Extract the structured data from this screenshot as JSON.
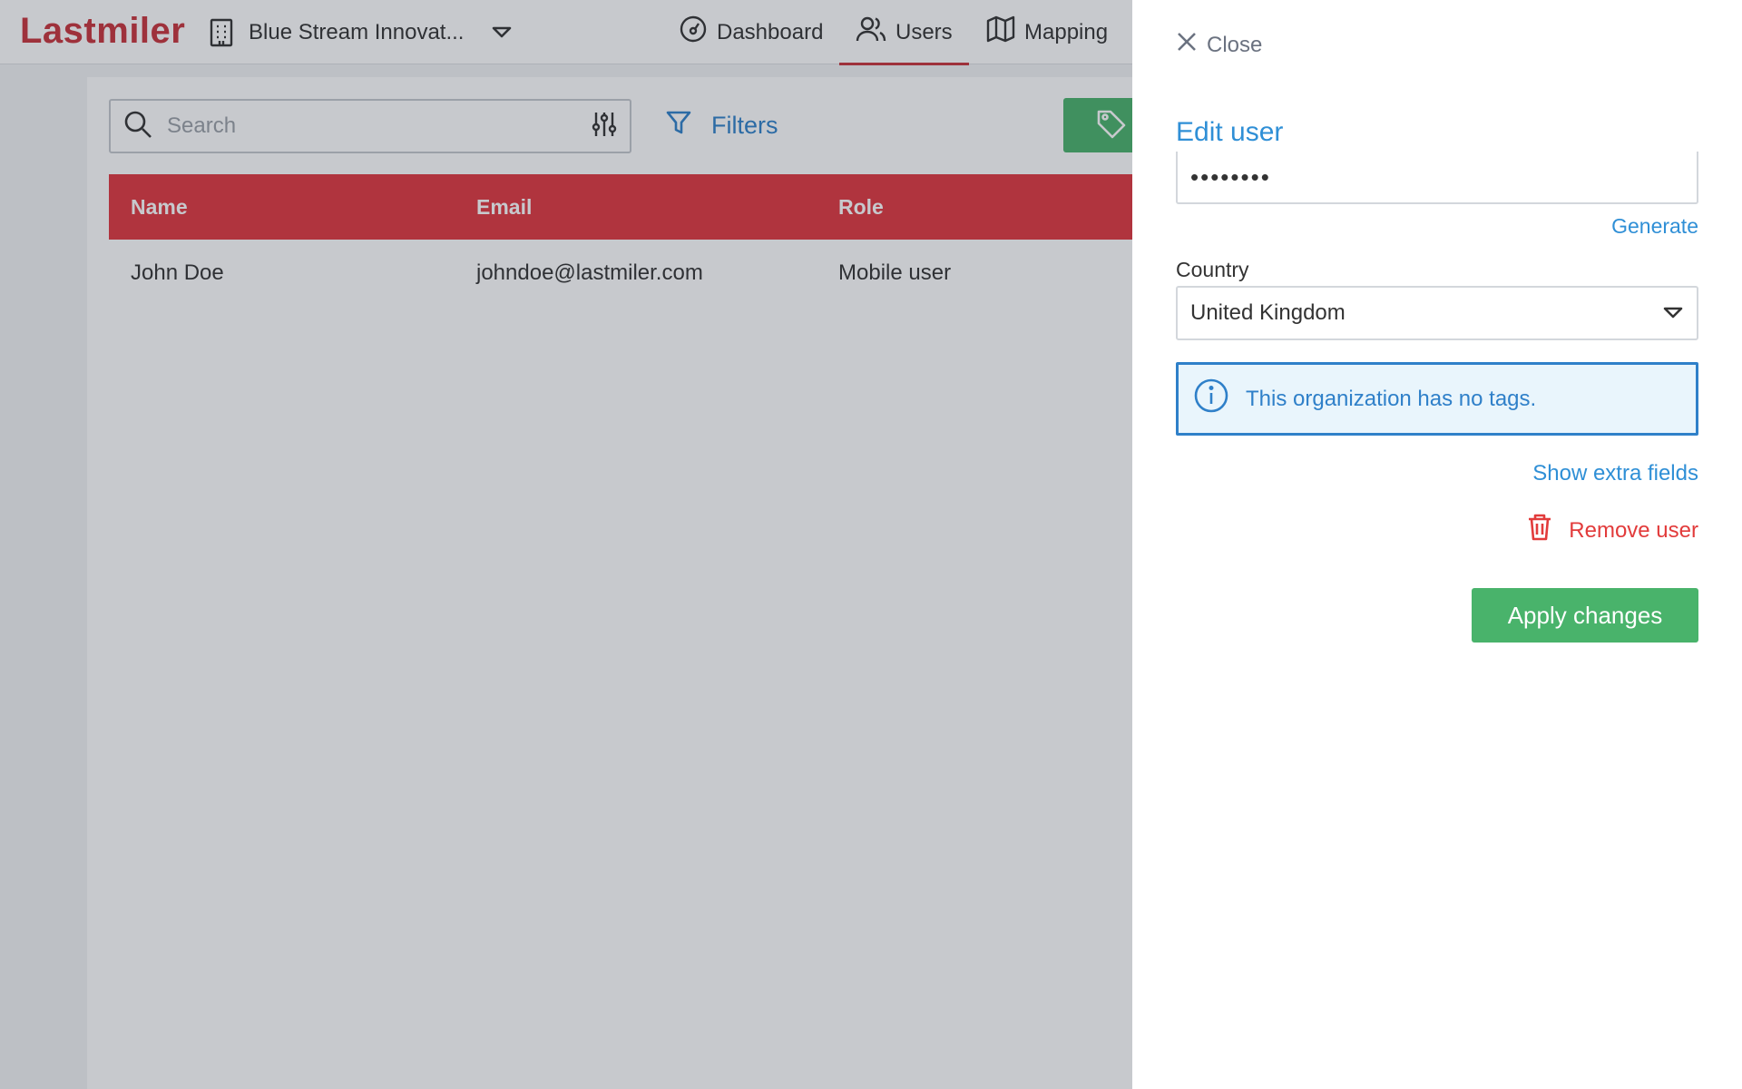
{
  "app": {
    "logo_text": "Lastmiler",
    "brand_color": "#c8323a"
  },
  "header": {
    "organization": "Blue Stream Innovat...",
    "nav": [
      {
        "label": "Dashboard",
        "icon": "dashboard-gauge-icon"
      },
      {
        "label": "Users",
        "icon": "users-icon",
        "active": true
      },
      {
        "label": "Mapping",
        "icon": "map-icon"
      }
    ]
  },
  "toolbar": {
    "search_placeholder": "Search",
    "filters_label": "Filters"
  },
  "table": {
    "columns": [
      "Name",
      "Email",
      "Role"
    ],
    "rows": [
      {
        "name": "John Doe",
        "email": "johndoe@lastmiler.com",
        "role": "Mobile user"
      }
    ]
  },
  "panel": {
    "close_label": "Close",
    "title": "Edit user",
    "password_value": "••••••••",
    "generate_label": "Generate",
    "country_label": "Country",
    "country_value": "United Kingdom",
    "info_text": "This organization has no tags.",
    "extra_fields_label": "Show extra fields",
    "remove_label": "Remove user",
    "apply_label": "Apply changes"
  }
}
